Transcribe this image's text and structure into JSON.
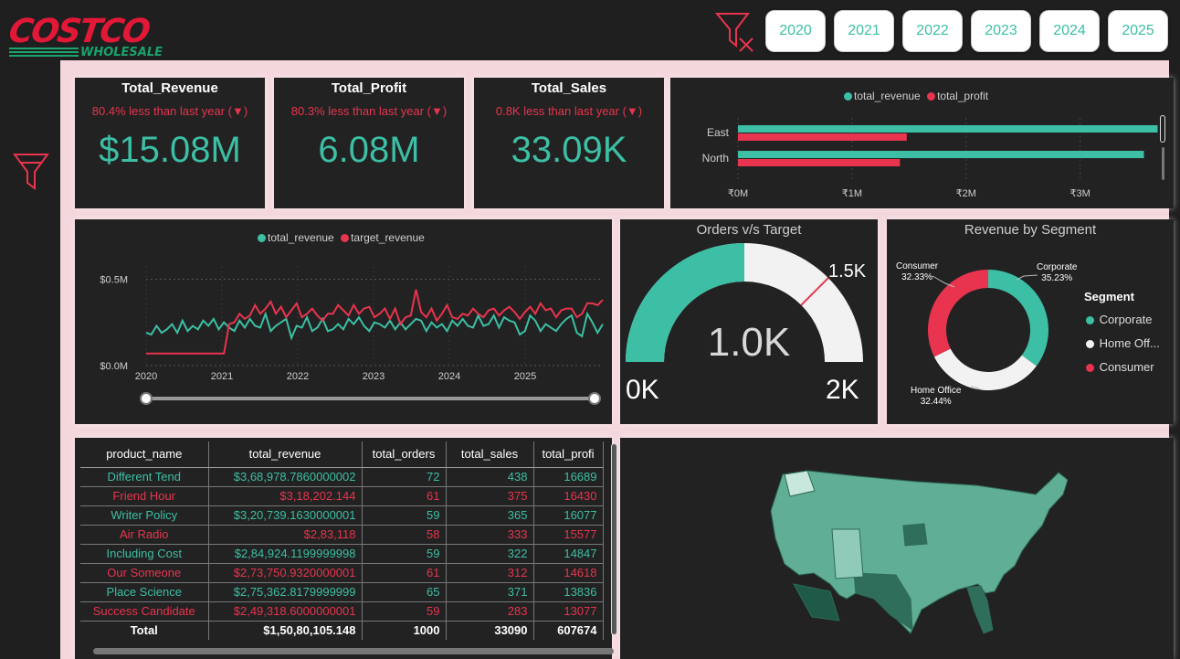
{
  "brand": {
    "line1": "COSTCO",
    "line2": "WHOLESALE"
  },
  "year_slicer": [
    "2020",
    "2021",
    "2022",
    "2023",
    "2024",
    "2025"
  ],
  "kpis": [
    {
      "title": "Total_Revenue",
      "subtitle": "80.4% less than last year (▼)",
      "value": "$15.08M"
    },
    {
      "title": "Total_Profit",
      "subtitle": "80.3% less than last year (▼)",
      "value": "6.08M"
    },
    {
      "title": "Total_Sales",
      "subtitle": "0.8K less than last year (▼)",
      "value": "33.09K"
    }
  ],
  "colors": {
    "teal": "#3cbfa4",
    "red": "#e8344e",
    "light": "#f2f2f2"
  },
  "region_chart": {
    "legend": [
      "total_revenue",
      "total_profit"
    ],
    "x_ticks": [
      "₹0M",
      "₹1M",
      "₹2M",
      "₹3M"
    ]
  },
  "trend_chart": {
    "legend": [
      "total_revenue",
      "target_revenue"
    ],
    "y_ticks": [
      "$0.5M",
      "$0.0M"
    ],
    "x_ticks": [
      "2020",
      "2021",
      "2022",
      "2023",
      "2024",
      "2025"
    ]
  },
  "gauge": {
    "title": "Orders v/s Target",
    "value": "1.0K",
    "target_label": "1.5K",
    "min_label": "0K",
    "max_label": "2K"
  },
  "segment_chart": {
    "title": "Revenue by Segment",
    "legend_title": "Segment",
    "legend": [
      "Corporate",
      "Home Off...",
      "Consumer"
    ],
    "labels": [
      {
        "name": "Consumer",
        "pct": "32.33%"
      },
      {
        "name": "Corporate",
        "pct": "35.23%"
      },
      {
        "name": "Home Office",
        "pct": "32.44%"
      }
    ]
  },
  "chart_data": [
    {
      "type": "bar",
      "orientation": "horizontal",
      "categories": [
        "East",
        "North"
      ],
      "series": [
        {
          "name": "total_revenue",
          "values": [
            3.68,
            3.56
          ]
        },
        {
          "name": "total_profit",
          "values": [
            1.48,
            1.42
          ]
        }
      ],
      "xlim": [
        0,
        3.7
      ],
      "x_ticks": [
        "₹0M",
        "₹1M",
        "₹2M",
        "₹3M"
      ],
      "legend": "top"
    },
    {
      "type": "line",
      "x_ticks": [
        "2020",
        "2021",
        "2022",
        "2023",
        "2024",
        "2025"
      ],
      "y_ticks": [
        "$0.0M",
        "$0.5M"
      ],
      "ylim": [
        0,
        0.55
      ],
      "series": [
        {
          "name": "total_revenue",
          "values": [
            0.19,
            0.18,
            0.23,
            0.19,
            0.21,
            0.24,
            0.19,
            0.26,
            0.2,
            0.23,
            0.21,
            0.26,
            0.23,
            0.27,
            0.21,
            0.25,
            0.22,
            0.2,
            0.26,
            0.22,
            0.27,
            0.23,
            0.22,
            0.3,
            0.2,
            0.23,
            0.25,
            0.27,
            0.16,
            0.23,
            0.22,
            0.28,
            0.2,
            0.22,
            0.27,
            0.2,
            0.21,
            0.24,
            0.21,
            0.27,
            0.24,
            0.28,
            0.23,
            0.2,
            0.25,
            0.24,
            0.22,
            0.26,
            0.21,
            0.25,
            0.21,
            0.24,
            0.27,
            0.26,
            0.2,
            0.25,
            0.22,
            0.24,
            0.2,
            0.26,
            0.23,
            0.27,
            0.23,
            0.22,
            0.29,
            0.23,
            0.24,
            0.29,
            0.22,
            0.28,
            0.26,
            0.25,
            0.18,
            0.2,
            0.29,
            0.26,
            0.2,
            0.24,
            0.22,
            0.2,
            0.24,
            0.27,
            0.29,
            0.19,
            0.17,
            0.3,
            0.25,
            0.19,
            0.24
          ]
        },
        {
          "name": "target_revenue",
          "values": [
            0.07,
            0.07,
            0.07,
            0.07,
            0.07,
            0.07,
            0.07,
            0.07,
            0.07,
            0.07,
            0.07,
            0.07,
            0.07,
            0.07,
            0.07,
            0.07,
            0.24,
            0.25,
            0.3,
            0.27,
            0.29,
            0.35,
            0.3,
            0.33,
            0.37,
            0.3,
            0.34,
            0.28,
            0.32,
            0.36,
            0.28,
            0.3,
            0.33,
            0.29,
            0.26,
            0.3,
            0.3,
            0.35,
            0.32,
            0.29,
            0.35,
            0.3,
            0.33,
            0.34,
            0.28,
            0.3,
            0.33,
            0.27,
            0.33,
            0.24,
            0.28,
            0.29,
            0.44,
            0.31,
            0.28,
            0.33,
            0.26,
            0.3,
            0.35,
            0.28,
            0.27,
            0.3,
            0.29,
            0.33,
            0.3,
            0.28,
            0.32,
            0.33,
            0.29,
            0.32,
            0.34,
            0.31,
            0.27,
            0.31,
            0.34,
            0.3,
            0.36,
            0.32,
            0.33,
            0.28,
            0.32,
            0.33,
            0.33,
            0.28,
            0.3,
            0.36,
            0.36,
            0.35,
            0.38
          ]
        }
      ],
      "legend": "top"
    },
    {
      "type": "gauge",
      "value": 1.0,
      "target": 1.5,
      "min": 0,
      "max": 2,
      "unit": "K"
    },
    {
      "type": "pie",
      "donut": true,
      "categories": [
        "Corporate",
        "Home Office",
        "Consumer"
      ],
      "values": [
        35.23,
        32.44,
        32.33
      ],
      "legend": "right"
    }
  ],
  "table": {
    "columns": [
      "product_name",
      "total_revenue",
      "total_orders",
      "total_sales",
      "total_profi"
    ],
    "rows": [
      [
        "Different Tend",
        "$3,68,978.7860000002",
        "72",
        "438",
        "16689"
      ],
      [
        "Friend Hour",
        "$3,18,202.144",
        "61",
        "375",
        "16430"
      ],
      [
        "Writer Policy",
        "$3,20,739.1630000001",
        "59",
        "365",
        "16077"
      ],
      [
        "Air Radio",
        "$2,83,118",
        "58",
        "333",
        "15577"
      ],
      [
        "Including Cost",
        "$2,84,924.1199999998",
        "59",
        "322",
        "14847"
      ],
      [
        "Our Someone",
        "$2,73,750.9320000001",
        "61",
        "312",
        "14618"
      ],
      [
        "Place Science",
        "$2,75,362.8179999999",
        "65",
        "371",
        "13836"
      ],
      [
        "Success Candidate",
        "$2,49,318.6000000001",
        "59",
        "283",
        "13077"
      ]
    ],
    "total": [
      "Total",
      "$1,50,80,105.148",
      "1000",
      "33090",
      "607674"
    ]
  },
  "map": {
    "region": "United States",
    "label": "state revenue map"
  }
}
